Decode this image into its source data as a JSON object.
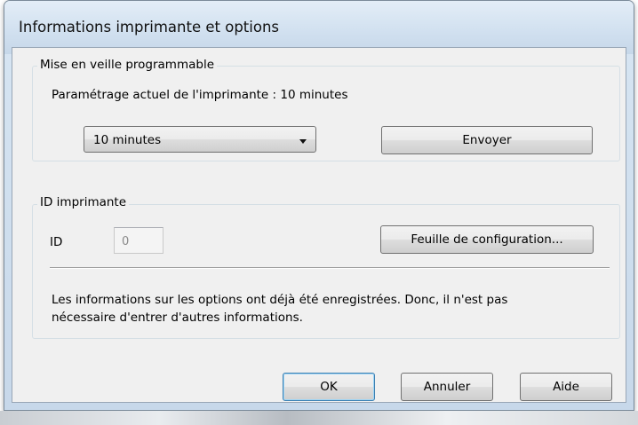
{
  "window": {
    "title": "Informations imprimante et options"
  },
  "sleep_group": {
    "legend": "Mise en veille programmable",
    "current_setting": "Paramétrage actuel de l'imprimante : 10 minutes",
    "combo_value": "10 minutes",
    "send_label": "Envoyer"
  },
  "printer_id_group": {
    "legend": "ID imprimante",
    "id_label": "ID",
    "id_value": "0",
    "config_sheet_label": "Feuille de configuration...",
    "info_line1": "Les informations sur les options ont déjà été enregistrées. Donc, il n'est pas",
    "info_line2": "nécessaire d'entrer d'autres informations."
  },
  "footer": {
    "ok_label": "OK",
    "cancel_label": "Annuler",
    "help_label": "Aide"
  },
  "icons": {
    "combo_arrow": "chevron-down-icon"
  }
}
